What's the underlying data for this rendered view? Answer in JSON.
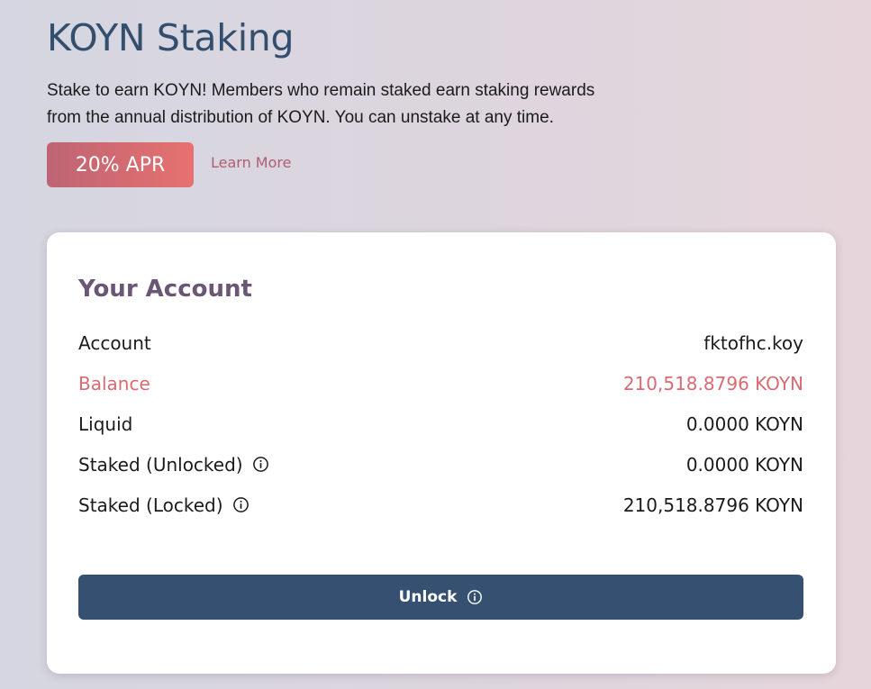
{
  "header": {
    "title": "KOYN Staking",
    "description": "Stake to earn KOYN! Members who remain staked earn staking rewards from the annual distribution of KOYN. You can unstake at any time.",
    "apr_badge": "20% APR",
    "learn_more": "Learn More"
  },
  "account": {
    "title": "Your Account",
    "rows": [
      {
        "label": "Account",
        "value": "fktofhc.koy",
        "info_icon": false
      },
      {
        "label": "Balance",
        "value": "210,518.8796 KOYN",
        "info_icon": false,
        "highlight": true
      },
      {
        "label": "Liquid",
        "value": "0.0000 KOYN",
        "info_icon": false
      },
      {
        "label": "Staked (Unlocked)",
        "value": "0.0000 KOYN",
        "info_icon": true
      },
      {
        "label": "Staked (Locked)",
        "value": "210,518.8796 KOYN",
        "info_icon": true
      }
    ],
    "unlock_button": "Unlock"
  },
  "colors": {
    "title": "#344f6e",
    "accent": "#e7716f",
    "highlight": "#d96b73",
    "button": "#355070"
  },
  "icons": {
    "row_info": "info-circle-icon",
    "button_info": "info-circle-icon"
  }
}
